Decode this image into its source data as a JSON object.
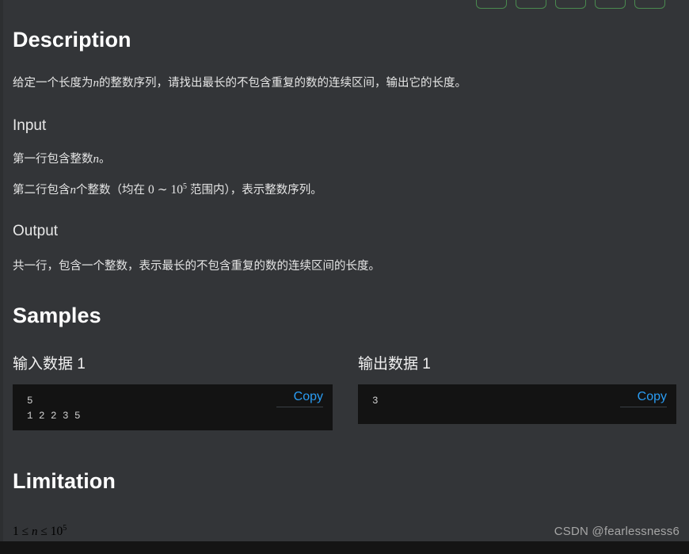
{
  "panel": {
    "background_color": "#333538",
    "bottom_strip_color": "#141414"
  },
  "tags": {
    "count": 5,
    "border_color": "#4a8a4f"
  },
  "description": {
    "heading": "Description",
    "text_prefix": "给定一个长度为",
    "text_var": "n",
    "text_suffix": "的整数序列，请找出最长的不包含重复的数的连续区间，输出它的长度。"
  },
  "input_section": {
    "heading": "Input",
    "line1_prefix": "第一行包含整数",
    "line1_var": "n",
    "line1_suffix": "。",
    "line2_prefix": "第二行包含",
    "line2_var": "n",
    "line2_mid": "个整数（均在 ",
    "line2_range_lo": "0",
    "line2_tilde": " ∼ ",
    "line2_range_hi_base": "10",
    "line2_range_hi_exp": "5",
    "line2_suffix": " 范围内），表示整数序列。"
  },
  "output_section": {
    "heading": "Output",
    "line1": "共一行，包含一个整数，表示最长的不包含重复的数的连续区间的长度。"
  },
  "samples": {
    "heading": "Samples",
    "input": {
      "label": "输入数据 1",
      "copy_label": "Copy",
      "lines": [
        "5",
        "1 2 2 3 5"
      ]
    },
    "output": {
      "label": "输出数据 1",
      "copy_label": "Copy",
      "lines": [
        "3"
      ]
    }
  },
  "limitation": {
    "heading": "Limitation",
    "expr_lo": "1",
    "expr_le1": " ≤ ",
    "expr_var": "n",
    "expr_le2": " ≤ ",
    "expr_hi_base": "10",
    "expr_hi_exp": "5"
  },
  "watermark": {
    "text": "CSDN @fearlessness6",
    "color": "#a6a6a6"
  }
}
